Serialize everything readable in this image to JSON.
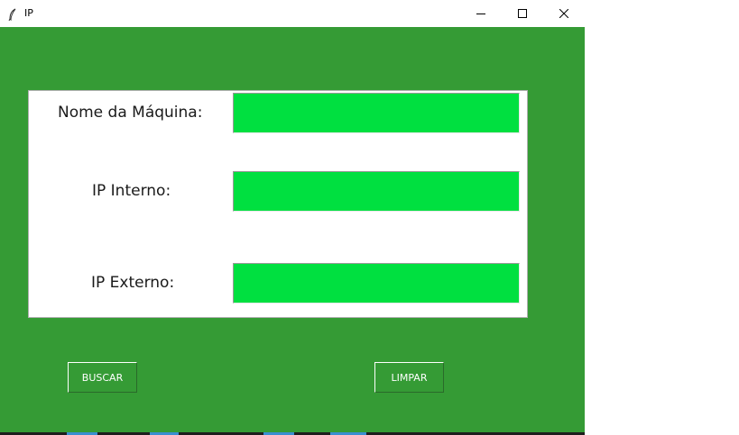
{
  "window": {
    "title": "IP",
    "app_icon": "feather-icon",
    "controls": {
      "minimize": "minimize-icon",
      "maximize": "maximize-icon",
      "close": "close-icon"
    }
  },
  "form": {
    "nome_label": "Nome da Máquina:",
    "nome_value": "",
    "interno_label": "IP Interno:",
    "interno_value": "",
    "externo_label": "IP Externo:",
    "externo_value": ""
  },
  "buttons": {
    "buscar": "BUSCAR",
    "limpar": "LIMPAR"
  },
  "colors": {
    "background": "#359b35",
    "field": "#00e040",
    "panel": "#ffffff"
  }
}
